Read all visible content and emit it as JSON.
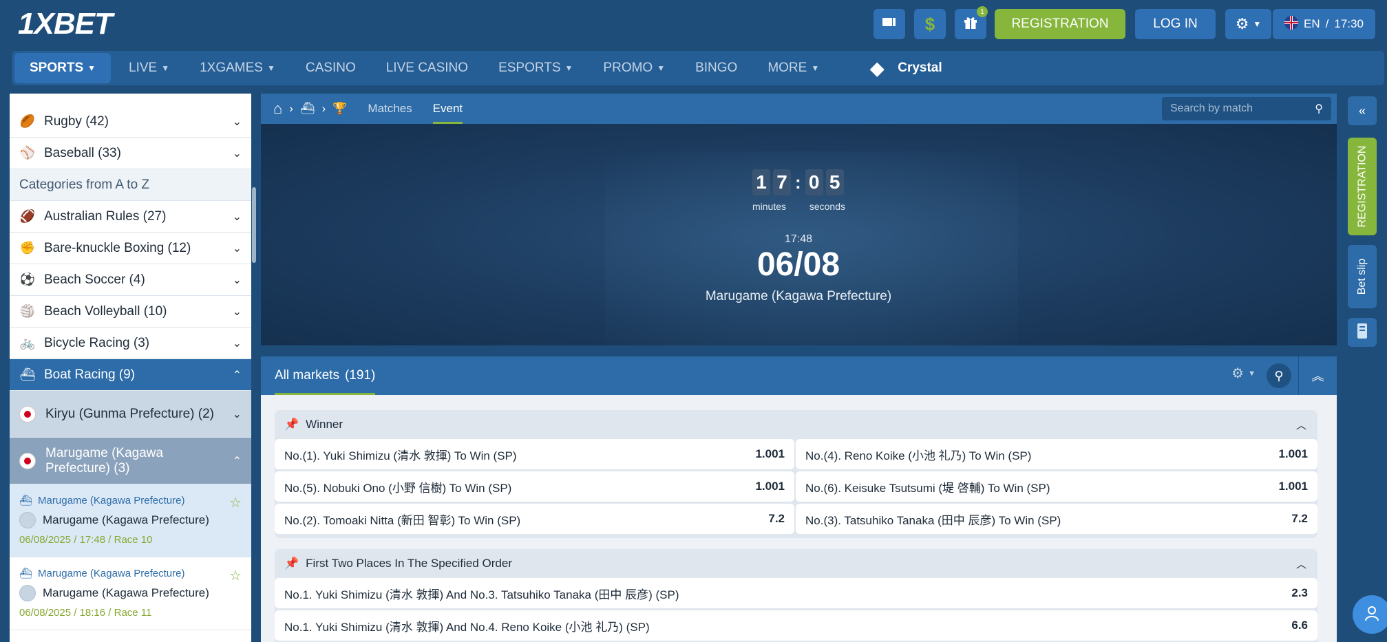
{
  "header": {
    "logo": "1XBET",
    "registration_label": "REGISTRATION",
    "login_label": "LOG IN",
    "gift_badge": "1",
    "lang": "EN",
    "separator": "/",
    "time": "17:30"
  },
  "nav": {
    "items": [
      {
        "label": "SPORTS"
      },
      {
        "label": "LIVE"
      },
      {
        "label": "1XGAMES"
      },
      {
        "label": "CASINO"
      },
      {
        "label": "LIVE CASINO"
      },
      {
        "label": "ESPORTS"
      },
      {
        "label": "PROMO"
      },
      {
        "label": "BINGO"
      },
      {
        "label": "MORE"
      }
    ],
    "crystal": "Crystal"
  },
  "sidebar": {
    "top_items": [
      {
        "label": "Rugby (42)",
        "icon": "rugby-ball-icon"
      },
      {
        "label": "Baseball (33)",
        "icon": "baseball-icon"
      }
    ],
    "category_header": "Categories from A to Z",
    "items": [
      {
        "label": "Australian Rules (27)",
        "icon": "football-icon"
      },
      {
        "label": "Bare-knuckle Boxing (12)",
        "icon": "boxing-icon"
      },
      {
        "label": "Beach Soccer (4)",
        "icon": "soccer-ball-icon"
      },
      {
        "label": "Beach Volleyball (10)",
        "icon": "volleyball-icon"
      },
      {
        "label": "Bicycle Racing (3)",
        "icon": "bicycle-icon"
      },
      {
        "label": "Boat Racing (9)",
        "icon": "boat-icon"
      }
    ],
    "sub_items": [
      {
        "label": "Kiryu (Gunma Prefecture) (2)"
      },
      {
        "label": "Marugame (Kagawa Prefecture) (3)"
      }
    ],
    "races": [
      {
        "league": "Marugame (Kagawa Prefecture)",
        "name": "Marugame (Kagawa Prefecture)",
        "info": "06/08/2025 / 17:48 / Race 10"
      },
      {
        "league": "Marugame (Kagawa Prefecture)",
        "name": "Marugame (Kagawa Prefecture)",
        "info": "06/08/2025 / 18:16 / Race 11"
      }
    ]
  },
  "breadcrumb": {
    "tabs": [
      {
        "label": "Matches"
      },
      {
        "label": "Event"
      }
    ],
    "search_placeholder": "Search by match"
  },
  "event": {
    "digits": [
      "1",
      "7",
      "0",
      "5"
    ],
    "colon": ":",
    "minutes_label": "minutes",
    "seconds_label": "seconds",
    "time": "17:48",
    "date": "06/08",
    "place": "Marugame (Kagawa Prefecture)"
  },
  "markets": {
    "title": "All markets",
    "count": "(191)",
    "groups": [
      {
        "title": "Winner",
        "rows": [
          [
            {
              "label": "No.(1). Yuki Shimizu (清水 敦揮) To Win (SP)",
              "odd": "1.001"
            },
            {
              "label": "No.(4). Reno Koike (小池 礼乃) To Win (SP)",
              "odd": "1.001"
            }
          ],
          [
            {
              "label": "No.(5). Nobuki Ono (小野 信樹) To Win (SP)",
              "odd": "1.001"
            },
            {
              "label": "No.(6). Keisuke Tsutsumi (堤 啓輔) To Win (SP)",
              "odd": "1.001"
            }
          ],
          [
            {
              "label": "No.(2). Tomoaki Nitta (新田 智彰) To Win (SP)",
              "odd": "7.2"
            },
            {
              "label": "No.(3). Tatsuhiko Tanaka (田中 辰彦) To Win (SP)",
              "odd": "7.2"
            }
          ]
        ]
      },
      {
        "title": "First Two Places In The Specified Order",
        "rows": [
          [
            {
              "label": "No.1. Yuki Shimizu (清水 敦揮) And No.3. Tatsuhiko Tanaka (田中 辰彦) (SP)",
              "odd": "2.3"
            }
          ],
          [
            {
              "label": "No.1. Yuki Shimizu (清水 敦揮) And No.4. Reno Koike (小池 礼乃) (SP)",
              "odd": "6.6"
            }
          ]
        ]
      }
    ]
  },
  "rail": {
    "registration": "REGISTRATION",
    "bet_slip": "Bet slip"
  },
  "colors": {
    "background": "#1f4d7a",
    "accent_green": "#86b63c",
    "blue": "#2d6ca8"
  }
}
